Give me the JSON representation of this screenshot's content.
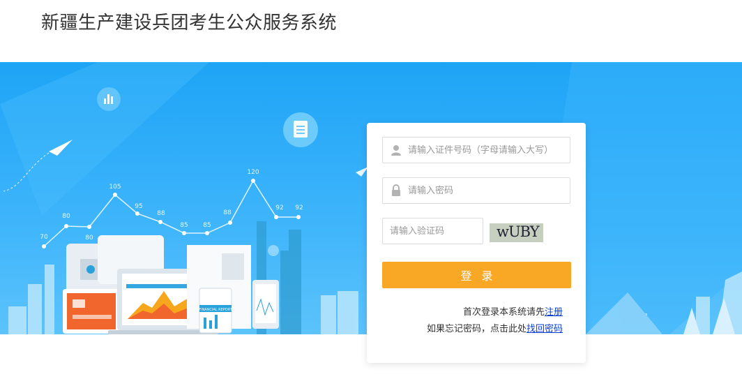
{
  "header": {
    "title": "新疆生产建设兵团考生公众服务系统"
  },
  "banner": {
    "chart_labels": [
      "70",
      "80",
      "80",
      "105",
      "95",
      "88",
      "85",
      "85",
      "88",
      "120",
      "92",
      "92"
    ],
    "report_label": "FINANCIAL REPORT"
  },
  "login": {
    "id_placeholder": "请输入证件号码（字母请输入大写）",
    "password_placeholder": "请输入密码",
    "captcha_placeholder": "请输入验证码",
    "captcha_text": "wUBY",
    "login_label": "登录",
    "register_prefix": "首次登录本系统请先",
    "register_link": "注册",
    "forgot_prefix": "如果忘记密码，点击此处",
    "forgot_link": "找回密码"
  },
  "colors": {
    "banner": "#1ea4f6",
    "button": "#f9a825",
    "link": "#0b3fd6"
  }
}
